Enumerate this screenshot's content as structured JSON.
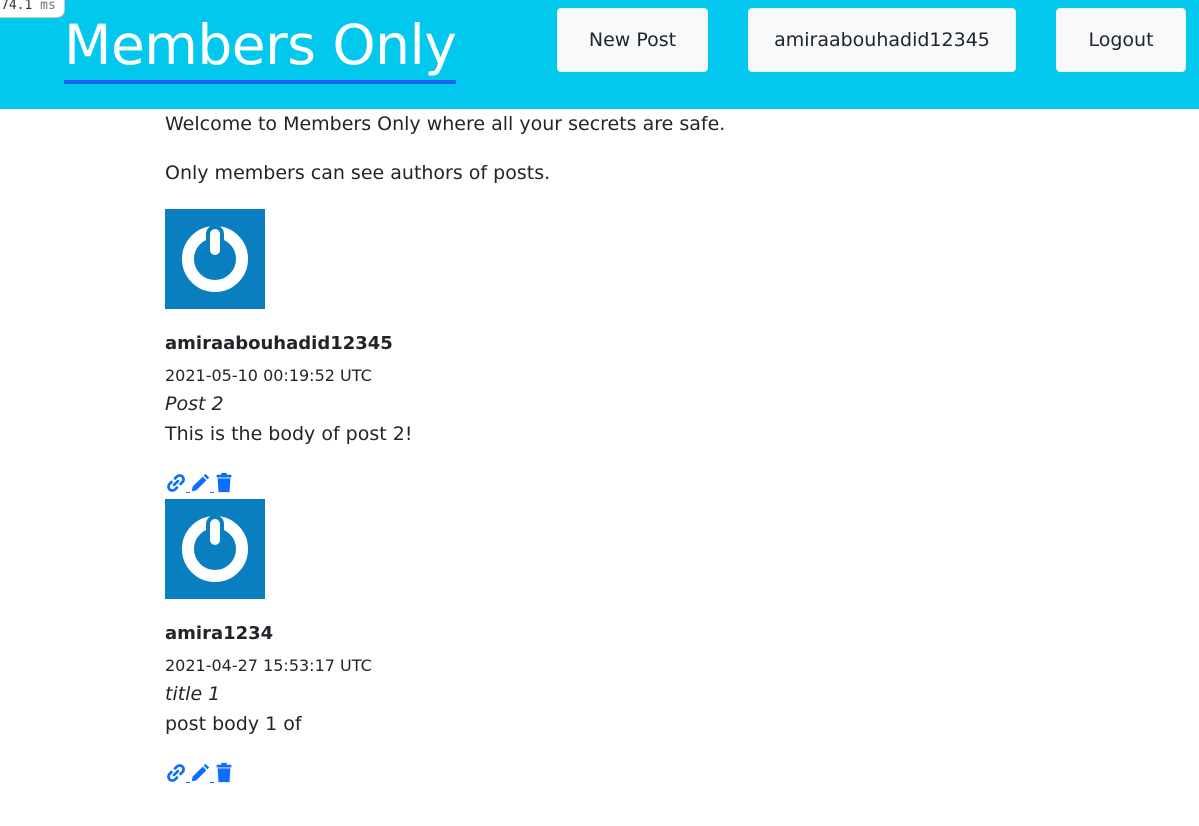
{
  "perf": {
    "value": "74.1",
    "unit": "ms"
  },
  "header": {
    "brand": "Members Only",
    "new_post_label": "New Post",
    "user_label": "amiraabouhadid12345",
    "logout_label": "Logout"
  },
  "intro": {
    "line1": "Welcome to Members Only where all your secrets are safe.",
    "line2": "Only members can see authors of posts."
  },
  "posts": [
    {
      "author": "amiraabouhadid12345",
      "timestamp": "2021-05-10 00:19:52 UTC",
      "title": "Post 2",
      "body": "This is the body of post 2!"
    },
    {
      "author": "amira1234",
      "timestamp": "2021-04-27 15:53:17 UTC",
      "title": "title 1",
      "body": "post body 1 of"
    }
  ],
  "icons": {
    "avatar": "power-icon",
    "show": "link-icon",
    "edit": "pencil-icon",
    "delete": "trash-icon"
  },
  "colors": {
    "header_bg": "#02c8ee",
    "brand_underline": "#1a66f0",
    "avatar_bg": "#0a7fbf",
    "action_icon": "#0d6efd",
    "button_bg": "#f8f9fa"
  }
}
